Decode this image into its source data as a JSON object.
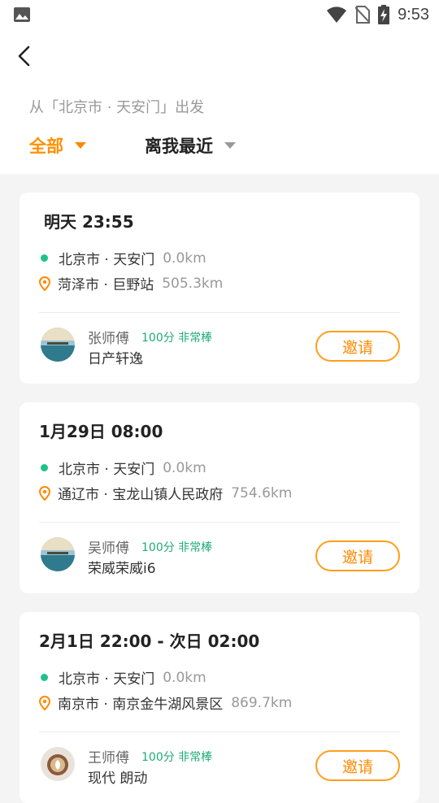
{
  "status_bar": {
    "time": "9:53"
  },
  "header": {
    "subtitle": "从「北京市 · 天安门」出发",
    "filter_all": "全部",
    "filter_sort": "离我最近"
  },
  "trips": [
    {
      "time": "明天 23:55",
      "from": "北京市 · 天安门",
      "from_dist": "0.0km",
      "to": "菏泽市 · 巨野站",
      "to_dist": "505.3km",
      "driver": "张师傅",
      "rating": "100分 非常棒",
      "car": "日产轩逸",
      "invite": "邀请"
    },
    {
      "time": "1月29日 08:00",
      "from": "北京市 · 天安门",
      "from_dist": "0.0km",
      "to": "通辽市 · 宝龙山镇人民政府",
      "to_dist": "754.6km",
      "driver": "吴师傅",
      "rating": "100分 非常棒",
      "car": "荣威荣威i6",
      "invite": "邀请"
    },
    {
      "time": "2月1日 22:00 - 次日 02:00",
      "from": "北京市 · 天安门",
      "from_dist": "0.0km",
      "to": "南京市 · 南京金牛湖风景区",
      "to_dist": "869.7km",
      "driver": "王师傅",
      "rating": "100分 非常棒",
      "car": "现代 朗动",
      "invite": "邀请"
    }
  ],
  "colors": {
    "accent": "#ff9000",
    "origin_dot": "#1fc18b",
    "rating": "#1fab78"
  }
}
